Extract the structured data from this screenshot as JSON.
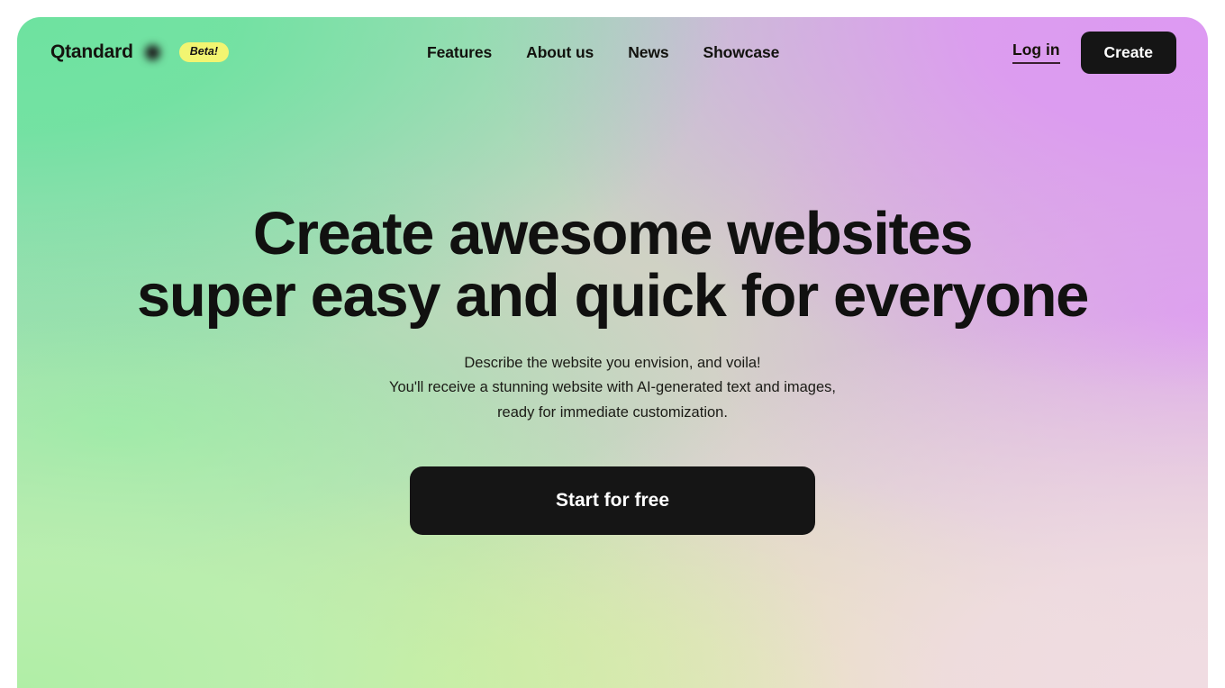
{
  "brand": {
    "name": "Qtandard",
    "dot_icon": "brand-dot-icon",
    "badge": "Beta!",
    "badge_color": "#f2f571"
  },
  "nav": {
    "items": [
      {
        "label": "Features"
      },
      {
        "label": "About us"
      },
      {
        "label": "News"
      },
      {
        "label": "Showcase"
      }
    ]
  },
  "auth": {
    "login_label": "Log in",
    "create_label": "Create"
  },
  "hero": {
    "headline_line1": "Create awesome websites",
    "headline_line2": "super easy and quick for everyone",
    "subhead_line1": "Describe the website you envision, and voila!",
    "subhead_line2": "You'll receive a stunning website with AI-generated text and images,",
    "subhead_line3": "ready for immediate customization.",
    "cta_label": "Start for free"
  },
  "theme": {
    "ink": "#151515",
    "accent_green": "#6ee2a0",
    "accent_purple": "#dd99f2",
    "accent_yellow": "#e2ee8c",
    "accent_pink": "#f0dce2",
    "badge_yellow": "#f2f571"
  }
}
